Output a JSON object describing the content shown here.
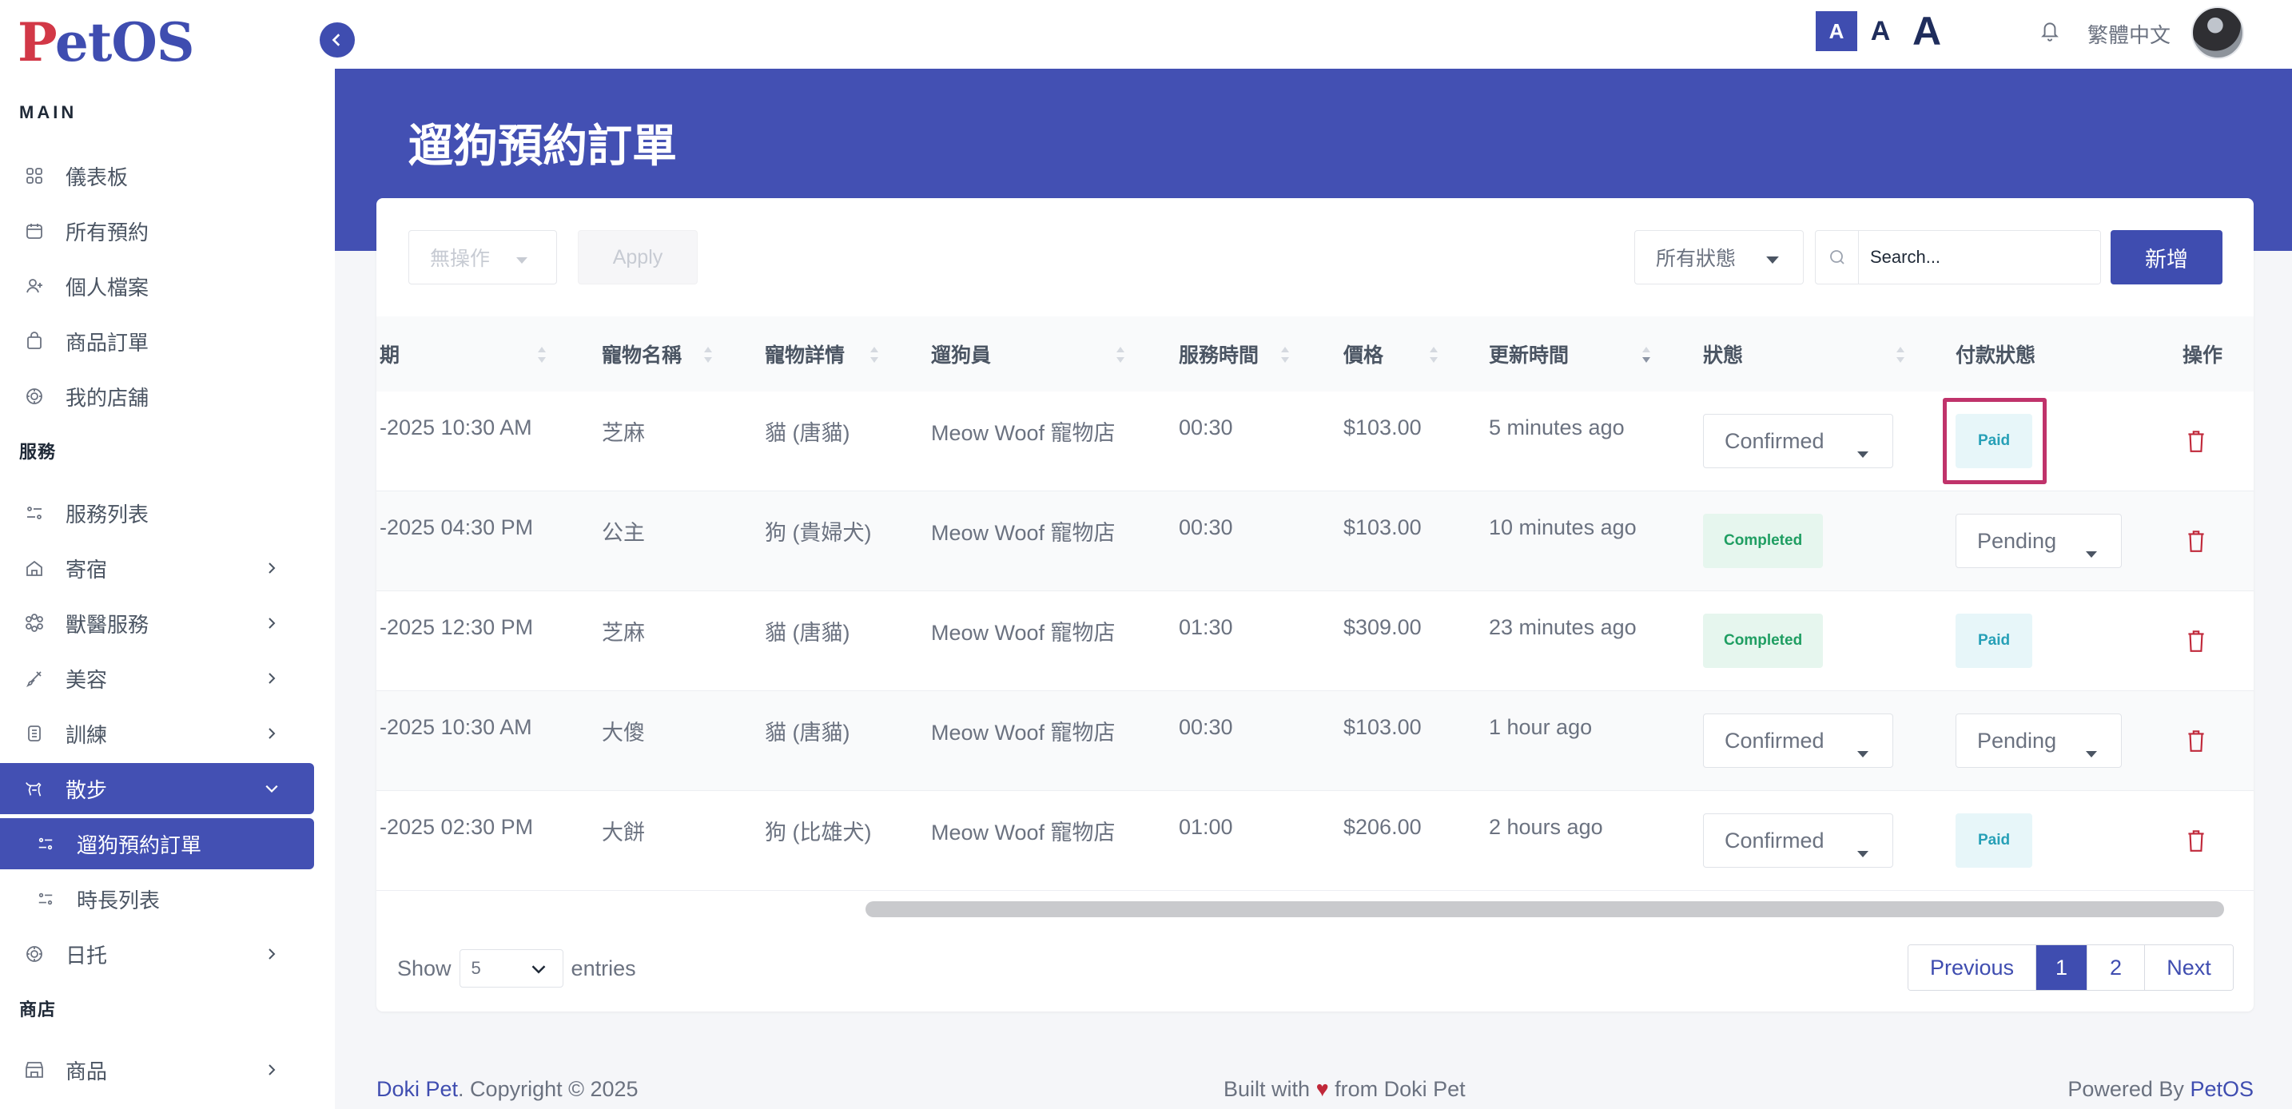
{
  "brand": {
    "logo_p": "P",
    "logo_rest": "etOS"
  },
  "sidebar": {
    "section_main": "MAIN",
    "main_items": [
      {
        "label": "儀表板",
        "icon": "grid-icon"
      },
      {
        "label": "所有預約",
        "icon": "calendar-icon"
      },
      {
        "label": "個人檔案",
        "icon": "user-add-icon"
      },
      {
        "label": "商品訂單",
        "icon": "shopping-bag-icon"
      },
      {
        "label": "我的店舖",
        "icon": "paw-icon"
      }
    ],
    "section_services": "服務",
    "service_items": [
      {
        "label": "服務列表",
        "icon": "list-toggle-icon"
      },
      {
        "label": "寄宿",
        "icon": "home-icon"
      },
      {
        "label": "獸醫服務",
        "icon": "paw-cluster-icon"
      },
      {
        "label": "美容",
        "icon": "brush-icon"
      },
      {
        "label": "訓練",
        "icon": "badge-icon"
      },
      {
        "label": "散步",
        "icon": "dog-walk-icon"
      },
      {
        "label": "遛狗預約訂單",
        "icon": "list-toggle-icon"
      },
      {
        "label": "時長列表",
        "icon": "list-toggle-icon"
      },
      {
        "label": "日托",
        "icon": "paw-icon"
      }
    ],
    "section_shop": "商店",
    "shop_items": [
      {
        "label": "商品",
        "icon": "store-icon"
      }
    ]
  },
  "topbar": {
    "font_small": "A",
    "font_medium": "A",
    "font_large": "A",
    "language": "繁體中文"
  },
  "page": {
    "title": "遛狗預約訂單"
  },
  "toolbar": {
    "bulk_action": "無操作",
    "apply": "Apply",
    "status_filter": "所有狀態",
    "search_placeholder": "Search...",
    "add": "新增"
  },
  "table": {
    "headers": [
      "期",
      "寵物名稱",
      "寵物詳情",
      "遛狗員",
      "服務時間",
      "價格",
      "更新時間",
      "狀態",
      "付款狀態",
      "操作"
    ],
    "rows": [
      {
        "date": "-2025 10:30 AM",
        "pet": "芝麻",
        "detail": "貓 (唐貓)",
        "walker": "Meow Woof 寵物店",
        "duration": "00:30",
        "price": "$103.00",
        "updated": "5 minutes ago",
        "status": "Confirmed",
        "status_kind": "select",
        "payment": "Paid",
        "payment_kind": "badge"
      },
      {
        "date": "-2025 04:30 PM",
        "pet": "公主",
        "detail": "狗 (貴婦犬)",
        "walker": "Meow Woof 寵物店",
        "duration": "00:30",
        "price": "$103.00",
        "updated": "10 minutes ago",
        "status": "Completed",
        "status_kind": "badge",
        "payment": "Pending",
        "payment_kind": "select"
      },
      {
        "date": "-2025 12:30 PM",
        "pet": "芝麻",
        "detail": "貓 (唐貓)",
        "walker": "Meow Woof 寵物店",
        "duration": "01:30",
        "price": "$309.00",
        "updated": "23 minutes ago",
        "status": "Completed",
        "status_kind": "badge",
        "payment": "Paid",
        "payment_kind": "badge"
      },
      {
        "date": "-2025 10:30 AM",
        "pet": "大傻",
        "detail": "貓 (唐貓)",
        "walker": "Meow Woof 寵物店",
        "duration": "00:30",
        "price": "$103.00",
        "updated": "1 hour ago",
        "status": "Confirmed",
        "status_kind": "select",
        "payment": "Pending",
        "payment_kind": "select"
      },
      {
        "date": "-2025 02:30 PM",
        "pet": "大餅",
        "detail": "狗 (比雄犬)",
        "walker": "Meow Woof 寵物店",
        "duration": "01:00",
        "price": "$206.00",
        "updated": "2 hours ago",
        "status": "Confirmed",
        "status_kind": "select",
        "payment": "Paid",
        "payment_kind": "badge"
      }
    ]
  },
  "pagination": {
    "show_label": "Show",
    "entries_value": "5",
    "entries_label": "entries",
    "previous": "Previous",
    "page1": "1",
    "page2": "2",
    "next": "Next"
  },
  "footer": {
    "brand": "Doki Pet",
    "copyright": ". Copyright © 2025",
    "built_with": "Built with",
    "heart": "♥",
    "from": "from Doki Pet",
    "powered_by": "Powered By",
    "powered_brand": "PetOS"
  },
  "colors": {
    "primary": "#4350b3",
    "danger": "#c0283a",
    "highlight": "#c0336b"
  }
}
